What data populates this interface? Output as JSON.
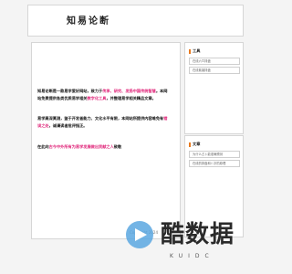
{
  "header": {
    "site_title": "知易论断"
  },
  "main": {
    "p1": {
      "a": "知易论断是一款易学爱好网站，致力于",
      "em1": "传承、研究、发扬中国传统智慧",
      "b": "。本网站免费提供各类优质易学相关",
      "em2": "数字化工具",
      "c": "，并整理易学相关精品文章。"
    },
    "p2": {
      "a": "易学高深莫测，鉴于开发者能力、文化水平有限，本网站所提供内容难免有",
      "em": "错误之处",
      "b": "，诚请读者批评指正。"
    },
    "p3": {
      "a": "在此向",
      "em": "古今中外所有为易学发展做出贡献之人",
      "b": "致敬"
    }
  },
  "sidebar": {
    "tools": {
      "title": "工具",
      "items": [
        "在线六爻排盘",
        "在线紫薇排盘"
      ]
    },
    "articles": {
      "title": "文章",
      "items": [
        "为什么占卜能准确预测",
        "在线的排盘和八字的原理"
      ]
    }
  },
  "footer": {
    "text": "Copyright 2024"
  },
  "watermark": {
    "text": "酷数据",
    "sub": "KUIDC"
  },
  "colors": {
    "accent": "#e0267a",
    "sidebar_bar": "#e8791d",
    "watermark_blue": "#5aa7e0"
  }
}
